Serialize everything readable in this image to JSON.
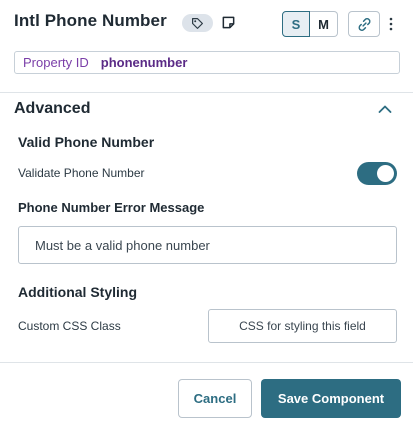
{
  "header": {
    "title": "Intl Phone Number",
    "icons": [
      "tag-icon",
      "note-icon",
      "link-icon",
      "more-vertical-icon"
    ],
    "size_options": [
      "S",
      "M"
    ],
    "selected_size": "S"
  },
  "property": {
    "label": "Property ID",
    "value": "phonenumber"
  },
  "advanced": {
    "title": "Advanced",
    "expanded": true,
    "valid_phone": {
      "heading": "Valid Phone Number",
      "validate_label": "Validate Phone Number",
      "validate_enabled": true
    },
    "error_message": {
      "label": "Phone Number Error Message",
      "value": "Must be a valid phone number"
    },
    "styling": {
      "heading": "Additional Styling",
      "css_label": "Custom CSS Class",
      "css_placeholder": "CSS for styling this field"
    }
  },
  "footer": {
    "cancel_label": "Cancel",
    "save_label": "Save Component"
  },
  "colors": {
    "accent": "#2d6d82",
    "property_label": "#7a3ea8",
    "property_value": "#5a2a86"
  }
}
